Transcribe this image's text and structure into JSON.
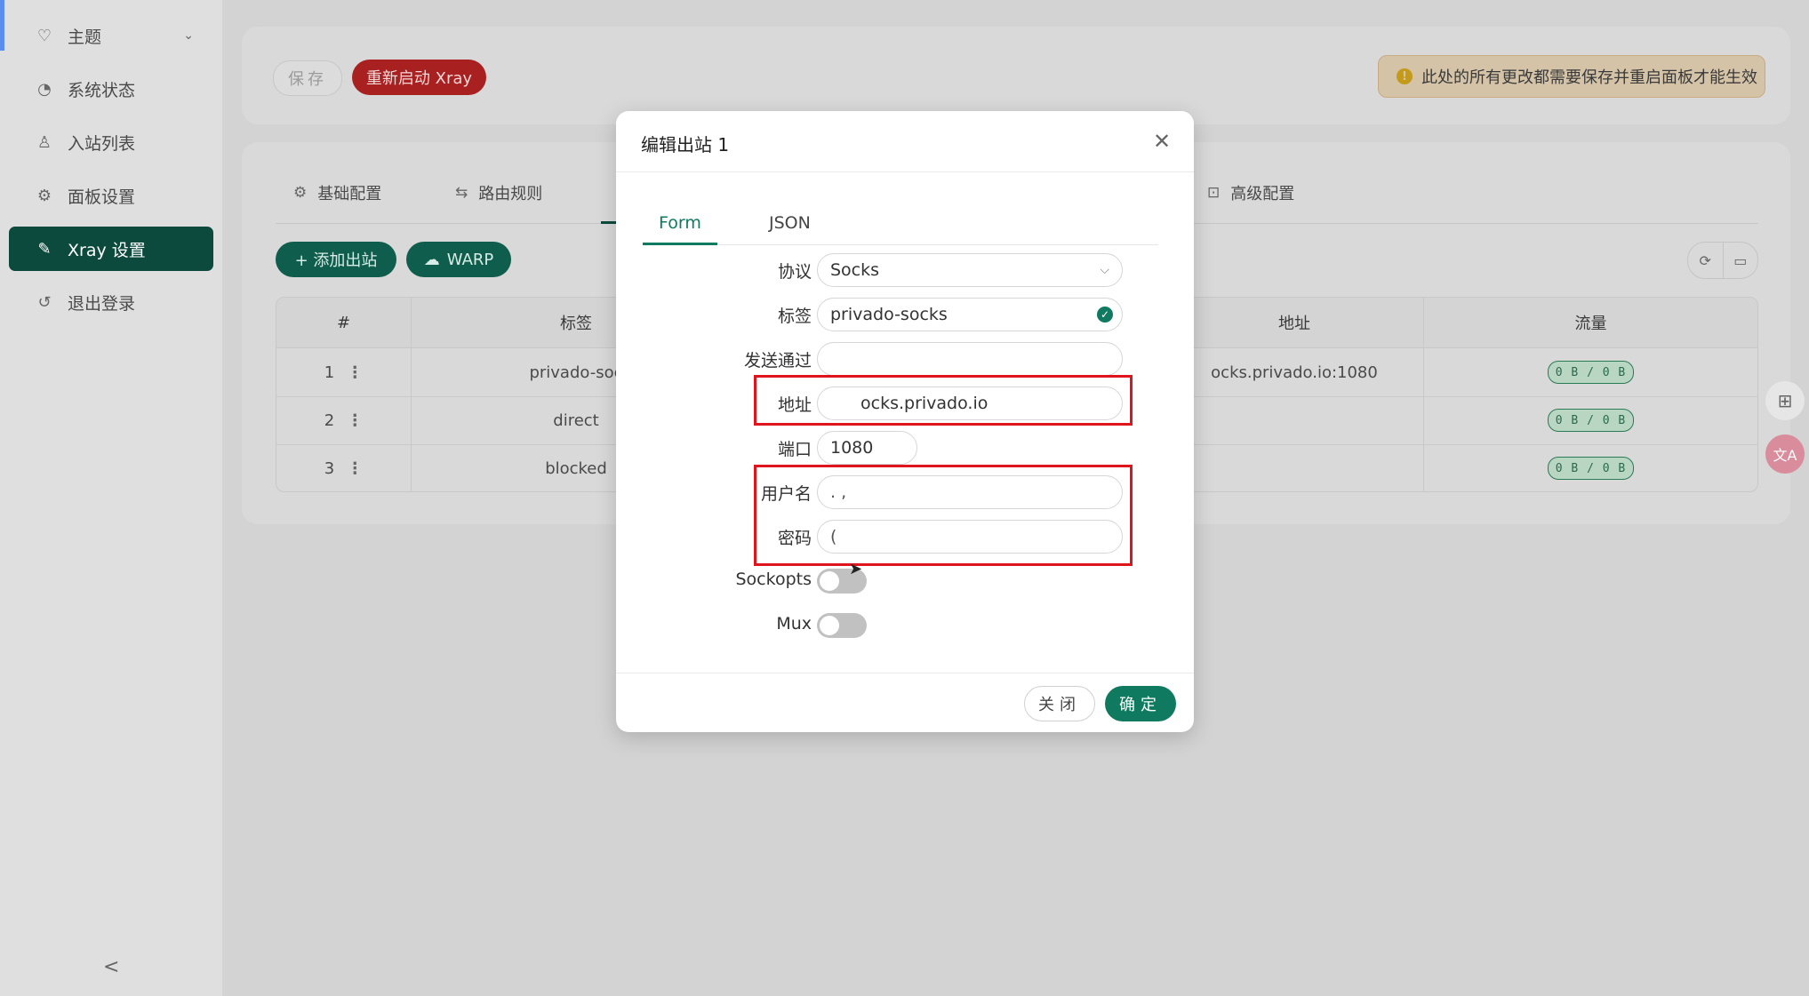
{
  "sidebar": {
    "items": [
      {
        "label": "主题",
        "icon": "bulb-icon",
        "glyph": "♡"
      },
      {
        "label": "系统状态",
        "icon": "dashboard-icon",
        "glyph": "◔"
      },
      {
        "label": "入站列表",
        "icon": "user-icon",
        "glyph": "♙"
      },
      {
        "label": "面板设置",
        "icon": "gear-icon",
        "glyph": "⚙"
      },
      {
        "label": "Xray 设置",
        "icon": "tool-icon",
        "glyph": "✎"
      },
      {
        "label": "退出登录",
        "icon": "logout-icon",
        "glyph": "↺"
      }
    ],
    "collapse_glyph": "<"
  },
  "toolbar": {
    "save_label": "保存",
    "restart_label": "重新启动 Xray",
    "warning_text": "此处的所有更改都需要保存并重启面板才能生效"
  },
  "tabs": [
    {
      "label": "基础配置",
      "icon": "gear-icon"
    },
    {
      "label": "路由规则",
      "icon": "swap-icon"
    },
    {
      "label": "高级配置",
      "icon": "code-icon"
    }
  ],
  "actions": {
    "add_outbound": "+ 添加出站",
    "warp": "WARP"
  },
  "table": {
    "headers": [
      "#",
      "标签",
      "地址",
      "流量"
    ],
    "rows": [
      {
        "index": "1",
        "tag": "privado-soc",
        "address": "ocks.privado.io:1080",
        "traffic": "0 B / 0 B"
      },
      {
        "index": "2",
        "tag": "direct",
        "address": "",
        "traffic": "0 B / 0 B"
      },
      {
        "index": "3",
        "tag": "blocked",
        "address": "",
        "traffic": "0 B / 0 B"
      }
    ]
  },
  "modal": {
    "title": "编辑出站 1",
    "tabs": [
      "Form",
      "JSON"
    ],
    "fields": {
      "protocol_label": "协议",
      "protocol_value": "Socks",
      "tag_label": "标签",
      "tag_value": "privado-socks",
      "sendthrough_label": "发送通过",
      "sendthrough_value": "",
      "address_label": "地址",
      "address_value": "ocks.privado.io",
      "port_label": "端口",
      "port_value": "1080",
      "username_label": "用户名",
      "username_value": ".              ,",
      "password_label": "密码",
      "password_value": "(",
      "sockopts_label": "Sockopts",
      "mux_label": "Mux"
    },
    "cancel_label": "关闭",
    "ok_label": "确定"
  },
  "colors": {
    "accent": "#0f7a60",
    "active_sidebar": "#0d4a3e",
    "restart": "#a82020",
    "highlight_box": "#e0141c"
  }
}
